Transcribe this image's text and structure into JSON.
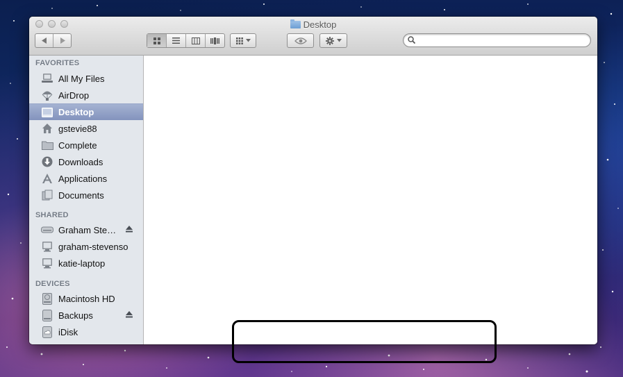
{
  "window": {
    "title": "Desktop"
  },
  "toolbar": {
    "nav": [
      "back",
      "forward"
    ],
    "views": [
      "icon-view",
      "list-view",
      "column-view",
      "coverflow-view"
    ],
    "active_view": "icon-view",
    "search_placeholder": ""
  },
  "sidebar": {
    "favorites_header": "FAVORITES",
    "favorites": [
      {
        "label": "All My Files",
        "icon": "all-files-icon"
      },
      {
        "label": "AirDrop",
        "icon": "airdrop-icon"
      },
      {
        "label": "Desktop",
        "icon": "desktop-icon",
        "selected": true
      },
      {
        "label": "gstevie88",
        "icon": "home-icon"
      },
      {
        "label": "Complete",
        "icon": "folder-icon"
      },
      {
        "label": "Downloads",
        "icon": "downloads-icon"
      },
      {
        "label": "Applications",
        "icon": "applications-icon"
      },
      {
        "label": "Documents",
        "icon": "documents-icon"
      }
    ],
    "shared_header": "SHARED",
    "shared": [
      {
        "label": "Graham Ste…",
        "icon": "server-icon",
        "eject": true
      },
      {
        "label": "graham-stevenso",
        "icon": "computer-icon"
      },
      {
        "label": "katie-laptop",
        "icon": "computer-icon"
      }
    ],
    "devices_header": "DEVICES",
    "devices": [
      {
        "label": "Macintosh HD",
        "icon": "hard-drive-icon"
      },
      {
        "label": "Backups",
        "icon": "external-drive-icon",
        "eject": true
      },
      {
        "label": "iDisk",
        "icon": "idisk-icon"
      }
    ]
  },
  "colors": {
    "selection": "#8393bd",
    "sidebar_bg": "#e3e7ec",
    "header_text": "#727a85"
  }
}
